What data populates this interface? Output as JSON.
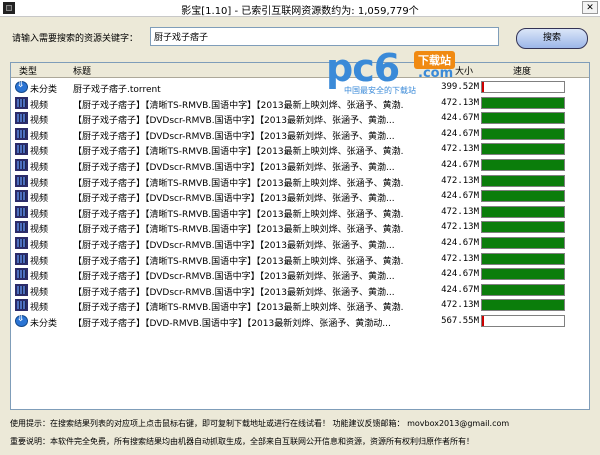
{
  "window": {
    "title": "影宝[1.10] - 已索引互联网资源数约为: 1,059,779个",
    "close_label": "✕"
  },
  "search": {
    "label": "请输入需要搜索的资源关键字：",
    "value": "厨子戏子痞子",
    "button": "搜索"
  },
  "logo": {
    "brand": "pc6",
    "badge": "下载站",
    "domain": ".com",
    "tagline": "中国最安全的下载站"
  },
  "columns": {
    "type": "类型",
    "title": "标题",
    "size": "大小",
    "speed": "速度"
  },
  "rows": [
    {
      "icon": "download-icon",
      "type": "未分类",
      "name": "厨子戏子痞子.torrent",
      "size": "399.52M",
      "progress": 2,
      "color": "#cc0000"
    },
    {
      "icon": "video-icon",
      "type": "视频",
      "name": "【厨子戏子痞子】【清晰TS-RMVB.国语中字】【2013最新上映刘烨、张涵予、黄渤...",
      "size": "472.13M",
      "progress": 100,
      "color": "#0b7d0b"
    },
    {
      "icon": "video-icon",
      "type": "视频",
      "name": "【厨子戏子痞子】【DVDscr-RMVB.国语中字】【2013最新刘烨、张涵予、黄渤...",
      "size": "424.67M",
      "progress": 100,
      "color": "#0b7d0b"
    },
    {
      "icon": "video-icon",
      "type": "视频",
      "name": "【厨子戏子痞子】【DVDscr-RMVB.国语中字】【2013最新刘烨、张涵予、黄渤...",
      "size": "424.67M",
      "progress": 100,
      "color": "#0b7d0b"
    },
    {
      "icon": "video-icon",
      "type": "视频",
      "name": "【厨子戏子痞子】【清晰TS-RMVB.国语中字】【2013最新上映刘烨、张涵予、黄渤...",
      "size": "472.13M",
      "progress": 100,
      "color": "#0b7d0b"
    },
    {
      "icon": "video-icon",
      "type": "视频",
      "name": "【厨子戏子痞子】【DVDscr-RMVB.国语中字】【2013最新刘烨、张涵予、黄渤...",
      "size": "424.67M",
      "progress": 100,
      "color": "#0b7d0b"
    },
    {
      "icon": "video-icon",
      "type": "视频",
      "name": "【厨子戏子痞子】【清晰TS-RMVB.国语中字】【2013最新上映刘烨、张涵予、黄渤...",
      "size": "472.13M",
      "progress": 100,
      "color": "#0b7d0b"
    },
    {
      "icon": "video-icon",
      "type": "视频",
      "name": "【厨子戏子痞子】【DVDscr-RMVB.国语中字】【2013最新刘烨、张涵予、黄渤...",
      "size": "424.67M",
      "progress": 100,
      "color": "#0b7d0b"
    },
    {
      "icon": "video-icon",
      "type": "视频",
      "name": "【厨子戏子痞子】【清晰TS-RMVB.国语中字】【2013最新上映刘烨、张涵予、黄渤...",
      "size": "472.13M",
      "progress": 100,
      "color": "#0b7d0b"
    },
    {
      "icon": "video-icon",
      "type": "视频",
      "name": "【厨子戏子痞子】【清晰TS-RMVB.国语中字】【2013最新上映刘烨、张涵予、黄渤...",
      "size": "472.13M",
      "progress": 100,
      "color": "#0b7d0b"
    },
    {
      "icon": "video-icon",
      "type": "视频",
      "name": "【厨子戏子痞子】【DVDscr-RMVB.国语中字】【2013最新刘烨、张涵予、黄渤...",
      "size": "424.67M",
      "progress": 100,
      "color": "#0b7d0b"
    },
    {
      "icon": "video-icon",
      "type": "视频",
      "name": "【厨子戏子痞子】【清晰TS-RMVB.国语中字】【2013最新上映刘烨、张涵予、黄渤...",
      "size": "472.13M",
      "progress": 100,
      "color": "#0b7d0b"
    },
    {
      "icon": "video-icon",
      "type": "视频",
      "name": "【厨子戏子痞子】【DVDscr-RMVB.国语中字】【2013最新刘烨、张涵予、黄渤...",
      "size": "424.67M",
      "progress": 100,
      "color": "#0b7d0b"
    },
    {
      "icon": "video-icon",
      "type": "视频",
      "name": "【厨子戏子痞子】【DVDscr-RMVB.国语中字】【2013最新刘烨、张涵予、黄渤...",
      "size": "424.67M",
      "progress": 100,
      "color": "#0b7d0b"
    },
    {
      "icon": "video-icon",
      "type": "视频",
      "name": "【厨子戏子痞子】【清晰TS-RMVB.国语中字】【2013最新上映刘烨、张涵予、黄渤...",
      "size": "472.13M",
      "progress": 100,
      "color": "#0b7d0b"
    },
    {
      "icon": "download-icon",
      "type": "未分类",
      "name": "【厨子戏子痞子】【DVD-RMVB.国语中字】【2013最新刘烨、张涵予、黄渤动...",
      "size": "567.55M",
      "progress": 2,
      "color": "#cc0000"
    }
  ],
  "footer": {
    "tip": "使用提示：在搜索结果列表的对应项上点击鼠标右键，即可复制下载地址或进行在线试看！  功能建议反馈邮箱：  movbox2013@gmail.com",
    "notice": "重要说明：本软件完全免费，所有搜索结果均由机器自动抓取生成，全部来自互联网公开信息和资源，资源所有权利归原作者所有！"
  }
}
